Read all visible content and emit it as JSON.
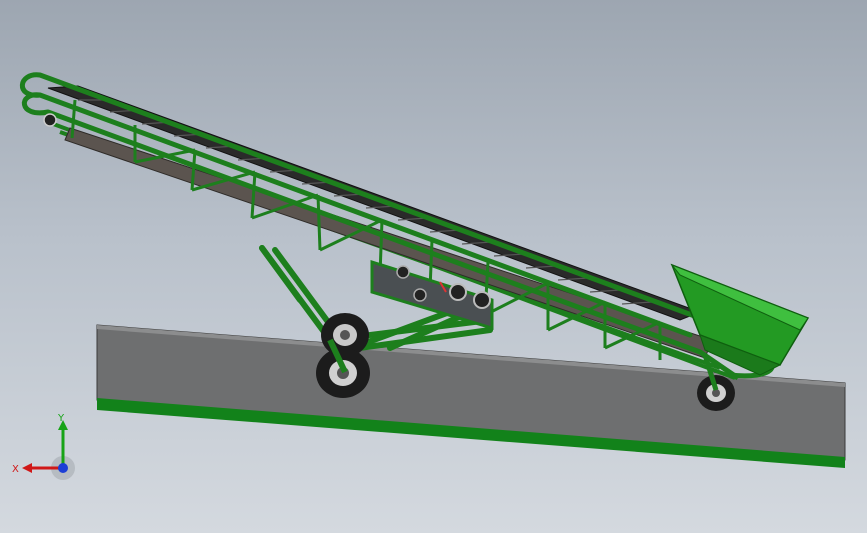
{
  "viewport": {
    "background_top": "#9da6b1",
    "background_bottom": "#d4d9df"
  },
  "model": {
    "frame_color": "#1d7f1d",
    "frame_highlight": "#3fae3f",
    "belt_color": "#2a2a2a",
    "slab_color": "#6e6f70",
    "slab_edge_color": "#12821a",
    "hopper_color": "#239a23",
    "tire_color": "#1c1c1c",
    "rim_color": "#c9c9c9"
  },
  "triad": {
    "x_label": "X",
    "y_label": "Y",
    "x_color": "#d01818",
    "y_color": "#17a317",
    "z_color": "#1d3fd6"
  }
}
